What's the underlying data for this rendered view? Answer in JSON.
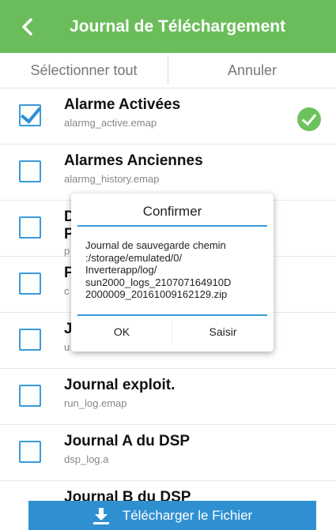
{
  "header": {
    "back_icon": "chevron-left-icon",
    "title": "Journal de Téléchargement",
    "bg": "#6bbd5b"
  },
  "actions": {
    "select_all": "Sélectionner tout",
    "cancel": "Annuler"
  },
  "items": [
    {
      "title": "Alarme Activées",
      "file": "alarmg_active.emap",
      "checked": true,
      "status_icon": "check-circle-icon"
    },
    {
      "title": "Alarmes Anciennes",
      "file": "alarmg_history.emap",
      "checked": false
    },
    {
      "title": "D",
      "title2": "P",
      "file": "p",
      "checked": false
    },
    {
      "title": "F",
      "file": "c",
      "checked": false
    },
    {
      "title": "J",
      "file": "u",
      "checked": false
    },
    {
      "title": "Journal exploit.",
      "file": "run_log.emap",
      "checked": false
    },
    {
      "title": "Journal A du DSP",
      "file": "dsp_log.a",
      "checked": false
    },
    {
      "title": "Journal B du DSP",
      "file": "",
      "checked": false
    }
  ],
  "dialog": {
    "title": "Confirmer",
    "message": "Journal de sauvegarde chemin\n:/storage/emulated/0/\nInverterapp/log/\nsun2000_logs_210707164910D\n2000009_20161009162129.zip",
    "ok": "OK",
    "cancel": "Saisir"
  },
  "download": {
    "icon": "download-icon",
    "label": "Télécharger le Fichier",
    "color": "#2f90d1"
  }
}
